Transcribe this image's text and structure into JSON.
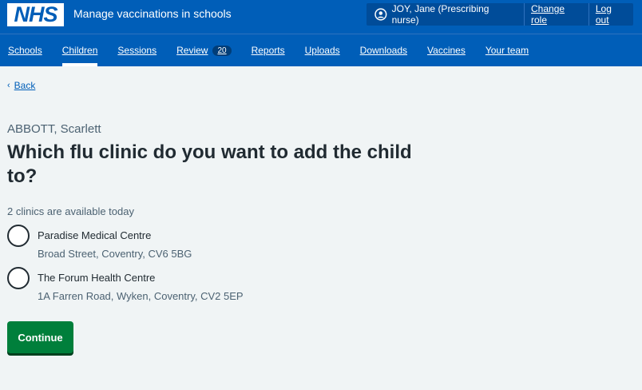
{
  "header": {
    "logo_text": "NHS",
    "service_name": "Manage vaccinations in schools",
    "account": {
      "user": "JOY, Jane (Prescribing nurse)",
      "change_role": "Change role",
      "log_out": "Log out"
    }
  },
  "nav": {
    "items": [
      {
        "label": "Schools"
      },
      {
        "label": "Children",
        "active": true
      },
      {
        "label": "Sessions"
      },
      {
        "label": "Review",
        "badge": "20"
      },
      {
        "label": "Reports"
      },
      {
        "label": "Uploads"
      },
      {
        "label": "Downloads"
      },
      {
        "label": "Vaccines"
      },
      {
        "label": "Your team"
      }
    ]
  },
  "back": {
    "chevron": "‹",
    "label": "Back"
  },
  "main": {
    "caption": "ABBOTT, Scarlett",
    "title": "Which flu clinic do you want to add the child to?",
    "hint": "2 clinics are available today",
    "options": [
      {
        "label": "Paradise Medical Centre",
        "address": "Broad Street, Coventry, CV6 5BG"
      },
      {
        "label": "The Forum Health Centre",
        "address": "1A Farren Road, Wyken, Coventry, CV2 5EP"
      }
    ],
    "continue_label": "Continue"
  },
  "colors": {
    "brand_blue": "#005eb8",
    "continue_green": "#007f3b",
    "background": "#f0f4f5"
  }
}
